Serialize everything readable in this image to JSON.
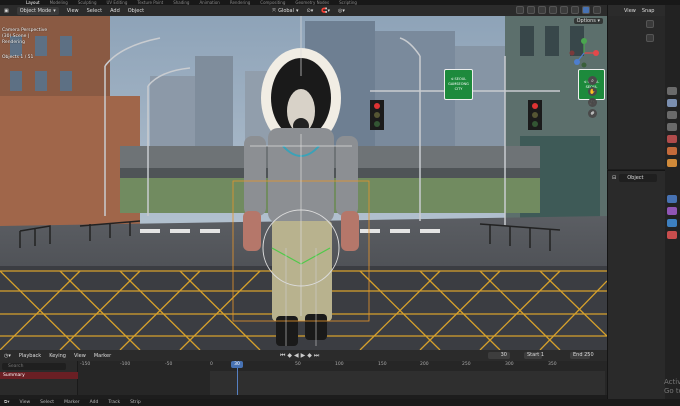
{
  "workspace_tabs": [
    "",
    "",
    "Layout",
    "Modeling",
    "Sculpting",
    "UV Editing",
    "Texture Paint",
    "Shading",
    "Animation",
    "Rendering",
    "Compositing",
    "Geometry Nodes",
    "Scripting"
  ],
  "viewport_header": {
    "mode": "Object Mode",
    "menus": [
      "View",
      "Select",
      "Add",
      "Object"
    ],
    "orientation": "Global"
  },
  "viewport_overlay": {
    "lines": [
      "Camera Perspective",
      "(30) Scene | ",
      "Rendering",
      "",
      "Objects 1 / 51"
    ]
  },
  "viewport_options": "Options",
  "street_signs": [
    {
      "lines": [
        "ᐊ SEOUL",
        "GAMSEONG",
        "CITY"
      ]
    },
    {
      "lines": [
        "ᐊ SEOUL",
        "SEOUL"
      ]
    }
  ],
  "timeline_header": {
    "menus": [
      "Playback",
      "Keying",
      "View",
      "Marker"
    ],
    "current_frame": "30",
    "start_label": "Start",
    "start": "1",
    "end_label": "End",
    "end": "250"
  },
  "timeline": {
    "search_placeholder": "Search",
    "summary": "Summary",
    "ruler": [
      "-150",
      "-100",
      "-50",
      "0",
      "30",
      "50",
      "100",
      "150",
      "200",
      "250",
      "300",
      "350"
    ],
    "cursor_frame": "30"
  },
  "statusbar": [
    "View",
    "Select",
    "Marker",
    "Add",
    "Track",
    "Strip"
  ],
  "outliner_header": {
    "menus": [
      "View",
      "Snap"
    ]
  },
  "properties": {
    "object_label": "Object"
  },
  "watermark": {
    "line1": "Activ",
    "line2": "Go to"
  }
}
